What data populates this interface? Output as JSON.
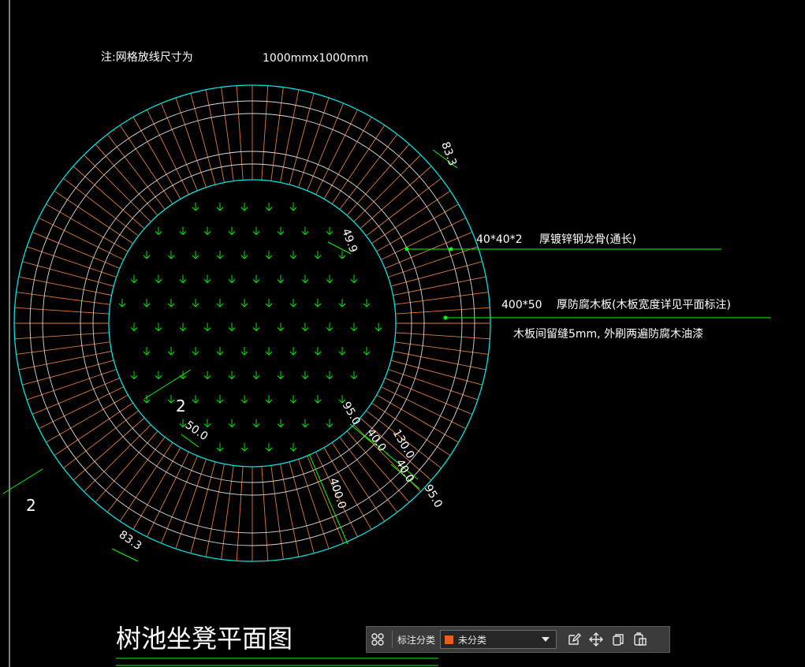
{
  "drawing": {
    "note_label": "注:网格放线尺寸为",
    "note_value": "1000mmx1000mm",
    "title": "树池坐凳平面图",
    "callout_1_spec": "40*40*2",
    "callout_1_text": "厚镀锌钢龙骨(通长)",
    "callout_2_spec": "400*50",
    "callout_2_text": "厚防腐木板(木板宽度详见平面标注)",
    "callout_3_text": "木板间留缝5mm, 外刷两遍防腐木油漆",
    "section_mark_inner": "2",
    "section_mark_outer": "2",
    "dims": {
      "d833_top": "83.3",
      "d499": "49.9",
      "d500": "50.0",
      "d950_a": "95.0",
      "d400_a": "40.0",
      "d1300": "130.0",
      "d400_b": "40.0",
      "d950_b": "95.0",
      "d4000": "400.0",
      "d833_bottom": "83.3"
    }
  },
  "toolbar": {
    "category_label": "标注分类",
    "category_value": "未分类",
    "category_color": "#e8601c",
    "icons": [
      "grid-icon",
      "edit-icon",
      "move-icon",
      "copy-icon",
      "paste-icon"
    ]
  },
  "colors": {
    "cyan": "#00e5e5",
    "orange": "#e07a3a",
    "green": "#00ff00",
    "white_lines": "#d9d9d9"
  }
}
